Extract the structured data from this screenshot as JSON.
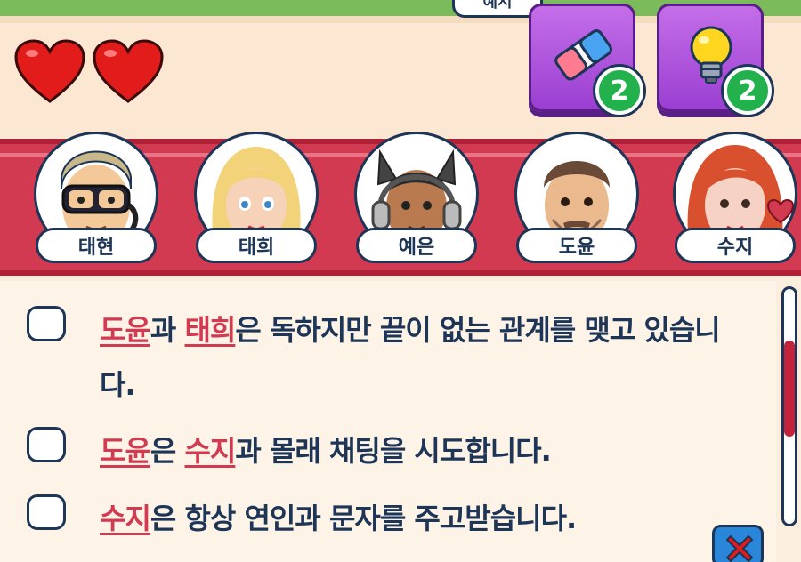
{
  "header": {
    "example_tab_label": "예시"
  },
  "lives": {
    "count": 2,
    "icon": "heart-icon",
    "color": "#e21b1b"
  },
  "powerups": [
    {
      "name": "eraser",
      "icon": "eraser-icon",
      "count": "2"
    },
    {
      "name": "hint",
      "icon": "lightbulb-icon",
      "count": "2"
    }
  ],
  "characters": [
    {
      "name": "태현",
      "icon": "diver-avatar-icon"
    },
    {
      "name": "태희",
      "icon": "blonde-woman-avatar-icon"
    },
    {
      "name": "예은",
      "icon": "cat-headphones-avatar-icon"
    },
    {
      "name": "도윤",
      "icon": "bearded-man-avatar-icon"
    },
    {
      "name": "수지",
      "icon": "redhead-woman-avatar-icon",
      "marked": true
    }
  ],
  "statements": [
    {
      "names": [
        "도윤",
        "태희"
      ],
      "parts": [
        "과 ",
        "은 독하지만 끝이 없는 관계를 맺고 있습니다."
      ]
    },
    {
      "names": [
        "도윤",
        "수지"
      ],
      "parts": [
        "은 ",
        "과 몰래 채팅을 시도합니다."
      ]
    },
    {
      "names": [
        "수지"
      ],
      "parts": [
        "은 항상 연인과 문자를 주고받습니다."
      ]
    }
  ],
  "colors": {
    "accent_red": "#d23a52",
    "navy": "#1d3557",
    "purple": "#9a3fd1",
    "green": "#22b14c"
  }
}
